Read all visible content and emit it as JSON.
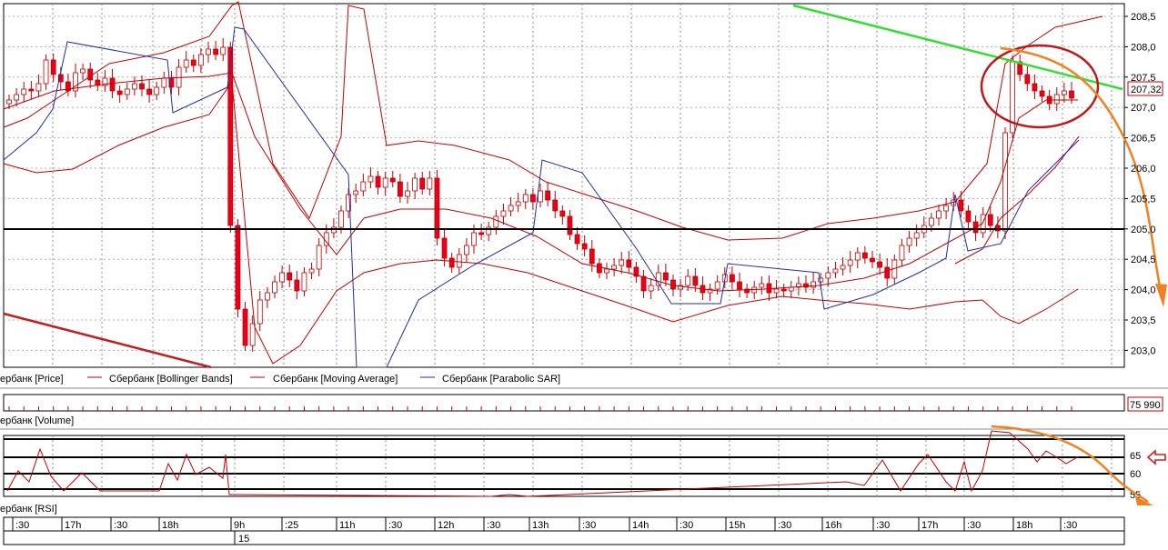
{
  "price_panel": {
    "y_axis_ticks": [
      "208,5",
      "208,0",
      "207,5",
      "207,0",
      "206,5",
      "206,0",
      "205,5",
      "205,0",
      "204,5",
      "204,0",
      "203,5",
      "203,0"
    ],
    "current_price_badge": "207,32",
    "hline_level": 205.0,
    "legend": [
      {
        "label": "ербанк [Price]",
        "color": "#c00000"
      },
      {
        "label": "Сбербанк [Bollinger Bands]",
        "color": "#c00000"
      },
      {
        "label": "Сбербанк [Moving Average]",
        "color": "#c00000"
      },
      {
        "label": "Сбербанк [Parabolic SAR]",
        "color": "#1f2fa0"
      }
    ]
  },
  "volume_panel": {
    "label": "ербанк [Volume]",
    "value_badge": "75 990"
  },
  "rsi_panel": {
    "label": "ербанк [RSI]",
    "ticks": [
      "65",
      "60",
      "55"
    ]
  },
  "time_axis": {
    "labels": [
      ":30",
      "17h",
      ":30",
      "18h",
      "9h",
      ":25",
      "11h",
      ":30",
      "12h",
      ":30",
      "13h",
      ":30",
      "14h",
      ":30",
      "15h",
      ":30",
      "16h",
      ":30",
      "17h",
      ":30",
      "18h",
      ":30"
    ],
    "date_label": "15"
  },
  "colors": {
    "candle": "#e8001c",
    "band": "#c00000",
    "sar": "#1f2fa0",
    "trend_green": "#33dd33",
    "trend_red": "#c02020",
    "annotation_orange": "#f08020",
    "annotation_circle": "#c01818",
    "grid": "#909090"
  }
}
